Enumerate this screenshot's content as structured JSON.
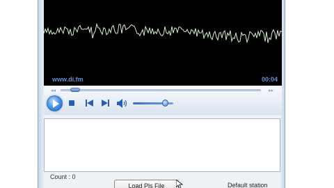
{
  "player": {
    "station_url": "www.di.fm",
    "elapsed_time": "00:04",
    "seek_left_glyph": "◂◂",
    "seek_right_glyph": "▸▸",
    "seek_position": 0.05,
    "volume_level": 0.8
  },
  "footer": {
    "count_label": "Count : 0",
    "load_pls_button": "Load Pls File",
    "default_station_label": "Default station"
  },
  "colors": {
    "visualizer_background": "#000000",
    "waveform": "#d8f0d0",
    "display_text": "#6a8fd0"
  }
}
